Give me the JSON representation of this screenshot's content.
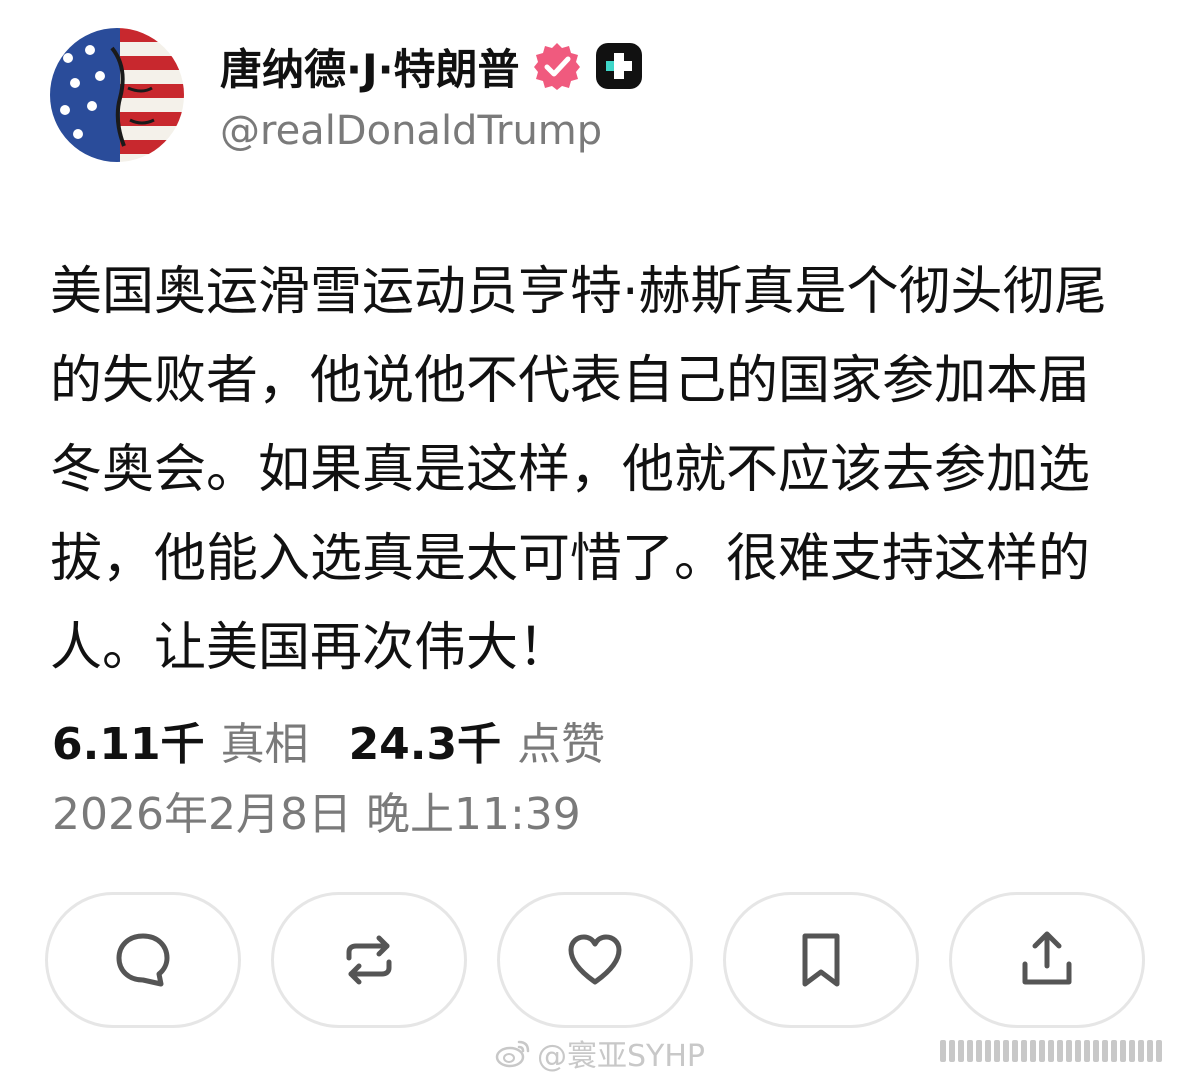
{
  "header": {
    "display_name": "唐纳德·J·特朗普",
    "handle": "@realDonaldTrump",
    "verified_icon": "verified-badge-icon",
    "app_badge_icon": "app-badge-icon",
    "verified_color": "#f05a7e"
  },
  "post": {
    "text": "美国奥运滑雪运动员亨特·赫斯真是个彻头彻尾的失败者，他说他不代表自己的国家参加本届冬奥会。如果真是这样，他就不应该去参加选拔，他能入选真是太可惜了。很难支持这样的人。让美国再次伟大！"
  },
  "stats": {
    "truths_value": "6.11千",
    "truths_label": "真相",
    "likes_value": "24.3千",
    "likes_label": "点赞"
  },
  "timestamp": "2026年2月8日 晚上11:39",
  "actions": [
    {
      "name": "reply-button",
      "icon": "comment-icon"
    },
    {
      "name": "retruth-button",
      "icon": "repost-icon"
    },
    {
      "name": "like-button",
      "icon": "heart-icon"
    },
    {
      "name": "bookmark-button",
      "icon": "bookmark-icon"
    },
    {
      "name": "share-button",
      "icon": "share-icon"
    }
  ],
  "watermark": {
    "text": "@寰亚SYHP",
    "icon": "weibo-icon"
  }
}
